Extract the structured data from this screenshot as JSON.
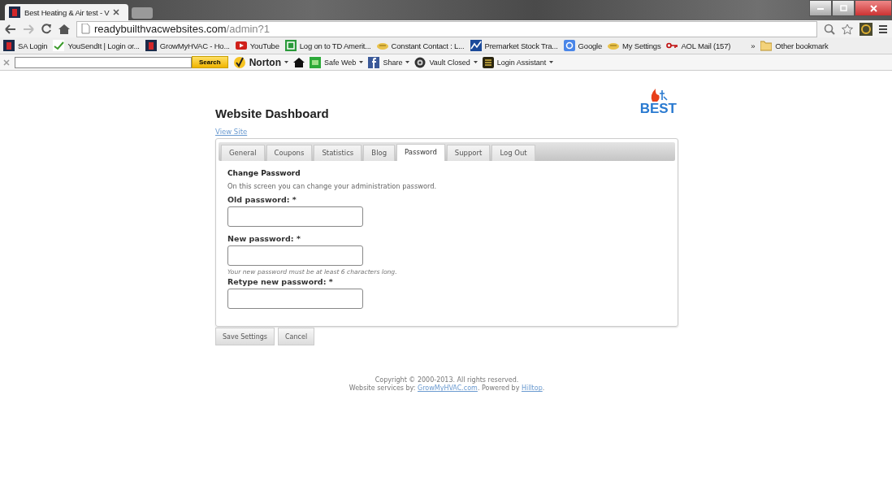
{
  "browser": {
    "tabs": [
      {
        "title": "Best Heating & Air test - V",
        "selected": true
      }
    ],
    "address": {
      "host": "readybuilthvacwebsites.com",
      "path": "/admin?1"
    },
    "bookmarks": [
      {
        "label": "SA Login",
        "kind": "site"
      },
      {
        "label": "YouSendIt | Login or...",
        "kind": "check"
      },
      {
        "label": "GrowMyHVAC - Ho...",
        "kind": "site"
      },
      {
        "label": "YouTube",
        "kind": "play"
      },
      {
        "label": "Log on to TD Amerit...",
        "kind": "td"
      },
      {
        "label": "Constant Contact : L...",
        "kind": "mail"
      },
      {
        "label": "Premarket Stock Tra...",
        "kind": "chart"
      },
      {
        "label": "Google",
        "kind": "google"
      },
      {
        "label": "My Settings",
        "kind": "mail"
      },
      {
        "label": "AOL Mail (157)",
        "kind": "key"
      }
    ],
    "bookmarks_more": "»",
    "other_bookmarks": "Other bookmark",
    "toolbar": {
      "search_button": "Search",
      "items": [
        {
          "label": "Norton",
          "kind": "norton",
          "dropdown": true
        },
        {
          "kind": "home",
          "dropdown": false
        },
        {
          "label": "Safe Web",
          "kind": "safeweb",
          "dropdown": true
        },
        {
          "label": "Share",
          "kind": "facebook",
          "dropdown": true
        },
        {
          "label": "Vault Closed",
          "kind": "vault",
          "dropdown": true
        },
        {
          "label": "Login Assistant",
          "kind": "login",
          "dropdown": true
        }
      ]
    }
  },
  "page": {
    "title": "Website Dashboard",
    "view_site": "View Site",
    "logo": "BEST",
    "tabs": [
      {
        "label": "General",
        "selected": false
      },
      {
        "label": "Coupons",
        "selected": false
      },
      {
        "label": "Statistics",
        "selected": false
      },
      {
        "label": "Blog",
        "selected": false
      },
      {
        "label": "Password",
        "selected": true
      },
      {
        "label": "Support",
        "selected": false
      },
      {
        "label": "Log Out",
        "selected": false
      }
    ],
    "heading": "Change Password",
    "intro": "On this screen you can change your administration password.",
    "fields": [
      {
        "label": "Old password: *"
      },
      {
        "label": "New password: *",
        "hint": "Your new password must be at least 6 characters long."
      },
      {
        "label": "Retype new password: *"
      }
    ],
    "buttons": [
      "Save Settings",
      "Cancel"
    ],
    "footer": {
      "copyright": "Copyright © 2000-2013. All rights reserved.",
      "services": "Website services by: ",
      "services_link": "GrowMyHVAC.com",
      "powered": ". Powered by ",
      "powered_link": "Hilltop",
      "end": "."
    }
  }
}
